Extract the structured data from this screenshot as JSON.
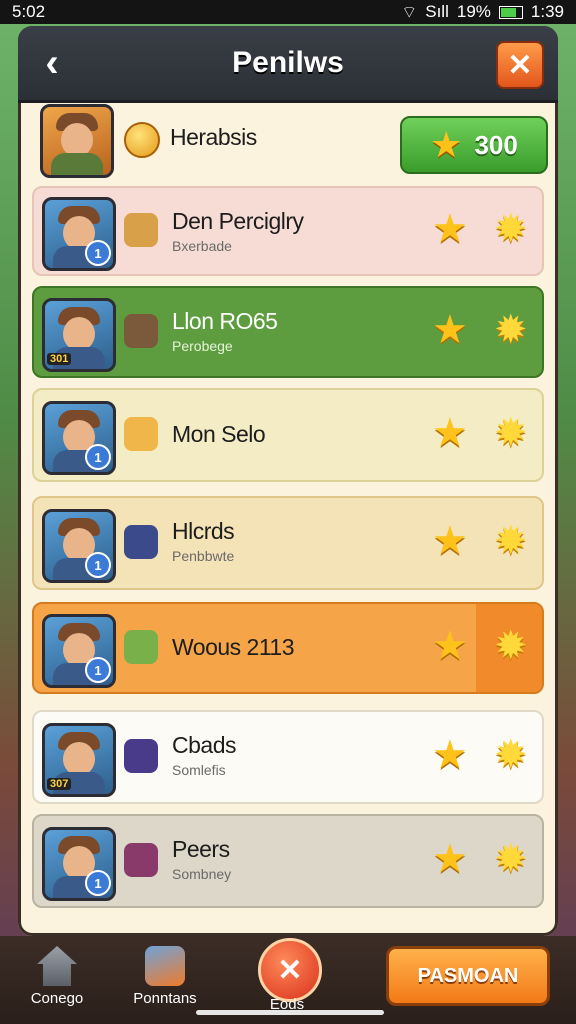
{
  "status": {
    "time": "5:02",
    "right_time": "1:39",
    "battery": "19%",
    "signal": "Sıll"
  },
  "header": {
    "back": "‹",
    "title": "Penilws",
    "close": "✕"
  },
  "top_row": {
    "name": "Herabsis",
    "reward_amount": "300"
  },
  "rows": [
    {
      "name": "Den Perciglry",
      "sub": "Bxerbade",
      "bg": "#f6dcd4",
      "border": "#e6c4b8"
    },
    {
      "name": "Llon RO65",
      "sub": "Perobege",
      "bg": "#5d9d3f",
      "border": "#3e7628",
      "level": "301"
    },
    {
      "name": "Mon Selo",
      "sub": "",
      "bg": "#f3ecc4",
      "border": "#ddd19a"
    },
    {
      "name": "Hlcrds",
      "sub": "Penbbwte",
      "bg": "#f5e3b8",
      "border": "#dfc78b"
    },
    {
      "name": "Woous 2113",
      "sub": "",
      "bg": "#f6a448",
      "border": "#d57d1c"
    },
    {
      "name": "Cbads",
      "sub": "Somlefis",
      "bg": "#fdfbf5",
      "border": "#e0d9c8",
      "level": "307"
    },
    {
      "name": "Peers",
      "sub": "Sombney",
      "bg": "#dcd7c8",
      "border": "#b8b2a0"
    }
  ],
  "bottom_nav": {
    "left_label": "Conego",
    "mid_label": "Ponntans",
    "center_label": "Eods",
    "cta_label": "PASMOAN"
  },
  "colors": {
    "accent_orange": "#f27a17",
    "accent_green": "#3a9c2b",
    "header_dark": "#2b2f36"
  }
}
